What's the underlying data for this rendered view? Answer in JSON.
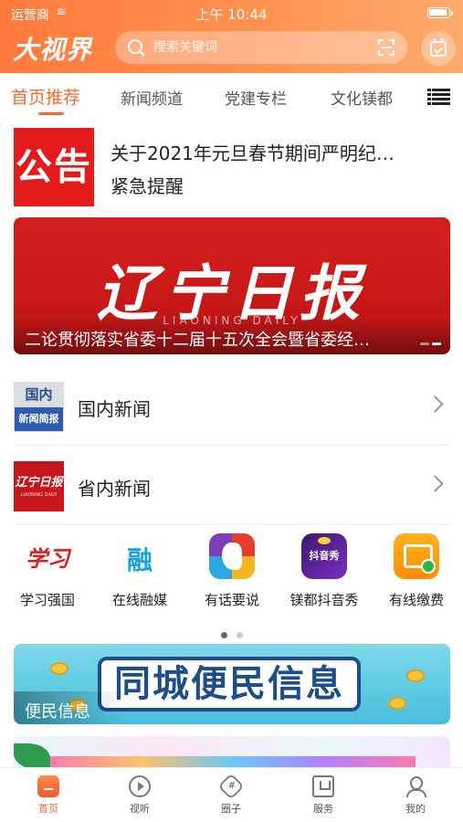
{
  "status": {
    "carrier": "运营商",
    "time": "上午 10:44"
  },
  "header": {
    "logo": "大视界",
    "search_placeholder": "搜索关键词"
  },
  "tabs": [
    {
      "label": "首页推荐",
      "active": true
    },
    {
      "label": "新闻频道",
      "active": false
    },
    {
      "label": "党建专栏",
      "active": false
    },
    {
      "label": "文化镁都",
      "active": false
    }
  ],
  "notice": {
    "badge": "公告",
    "line1": "关于2021年元旦春节期间严明纪…",
    "line2": "紧急提醒"
  },
  "banner": {
    "title": "辽宁日报",
    "subtitle": "LIAONING DAILY",
    "caption": "二论贯彻落实省委十二届十五次全会暨省委经…"
  },
  "news_rows": [
    {
      "label": "国内新闻",
      "thumb_top": "国内",
      "thumb_bottom": "新闻简报"
    },
    {
      "label": "省内新闻",
      "thumb_top": "辽宁日报",
      "thumb_bottom": "LIAONING DAILY"
    }
  ],
  "apps": [
    {
      "name": "学习强国",
      "icon": "xuexi-icon",
      "glyph": "学习"
    },
    {
      "name": "在线融媒",
      "icon": "rongmei-icon",
      "glyph": "融"
    },
    {
      "name": "有话要说",
      "icon": "youhua-icon",
      "glyph": ""
    },
    {
      "name": "镁都抖音秀",
      "icon": "douyin-icon",
      "glyph": "抖音秀"
    },
    {
      "name": "有线缴费",
      "icon": "tv-pay-icon",
      "glyph": ""
    }
  ],
  "promo": {
    "title": "同城便民信息",
    "label": "便民信息"
  },
  "bottom_nav": [
    {
      "label": "首页",
      "active": true
    },
    {
      "label": "视听",
      "active": false
    },
    {
      "label": "圈子",
      "active": false
    },
    {
      "label": "服务",
      "active": false
    },
    {
      "label": "我的",
      "active": false
    }
  ],
  "colors": {
    "accent": "#f26a2e",
    "header_start": "#ff7a3c",
    "notice_red": "#e31b1b"
  }
}
